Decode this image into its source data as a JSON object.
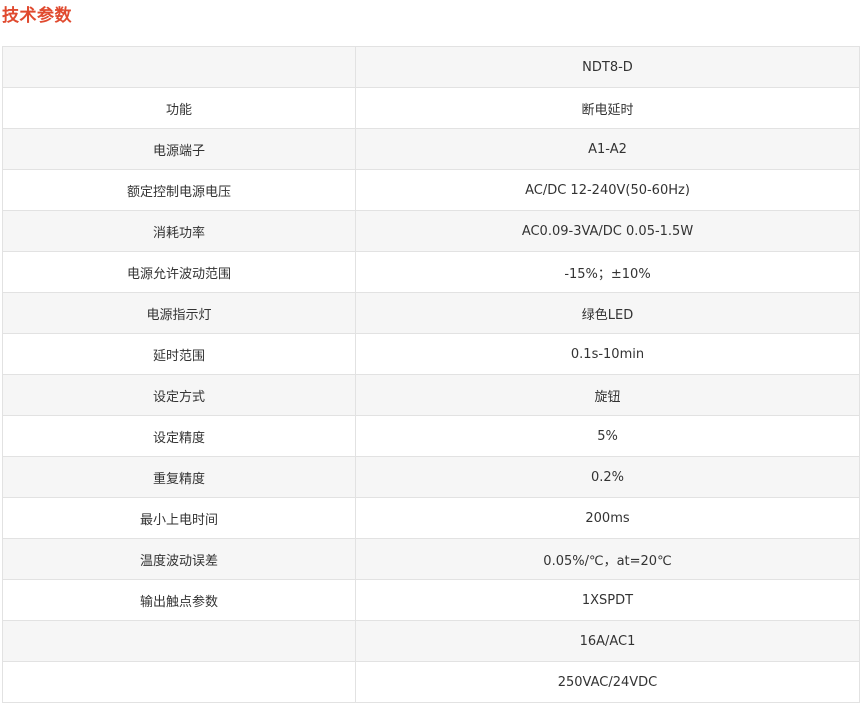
{
  "title": "技术参数",
  "colors": {
    "title": "#e04a2f",
    "row_shade": "#f6f6f6",
    "border": "#e2e2e2",
    "text": "#333333"
  },
  "rows": [
    {
      "label": "",
      "value": "NDT8-D"
    },
    {
      "label": "功能",
      "value": "断电延时"
    },
    {
      "label": "电源端子",
      "value": "A1-A2"
    },
    {
      "label": "额定控制电源电压",
      "value": "AC/DC 12-240V(50-60Hz)"
    },
    {
      "label": "消耗功率",
      "value": "AC0.09-3VA/DC 0.05-1.5W"
    },
    {
      "label": "电源允许波动范围",
      "value": "-15%；±10%"
    },
    {
      "label": "电源指示灯",
      "value": "绿色LED"
    },
    {
      "label": "延时范围",
      "value": "0.1s-10min"
    },
    {
      "label": "设定方式",
      "value": "旋钮"
    },
    {
      "label": "设定精度",
      "value": "5%"
    },
    {
      "label": "重复精度",
      "value": "0.2%"
    },
    {
      "label": "最小上电时间",
      "value": "200ms"
    },
    {
      "label": "温度波动误差",
      "value": "0.05%/℃，at=20℃"
    },
    {
      "label": "输出触点参数",
      "value": "1XSPDT"
    },
    {
      "label": "",
      "value": "16A/AC1"
    },
    {
      "label": "",
      "value": "250VAC/24VDC"
    }
  ]
}
